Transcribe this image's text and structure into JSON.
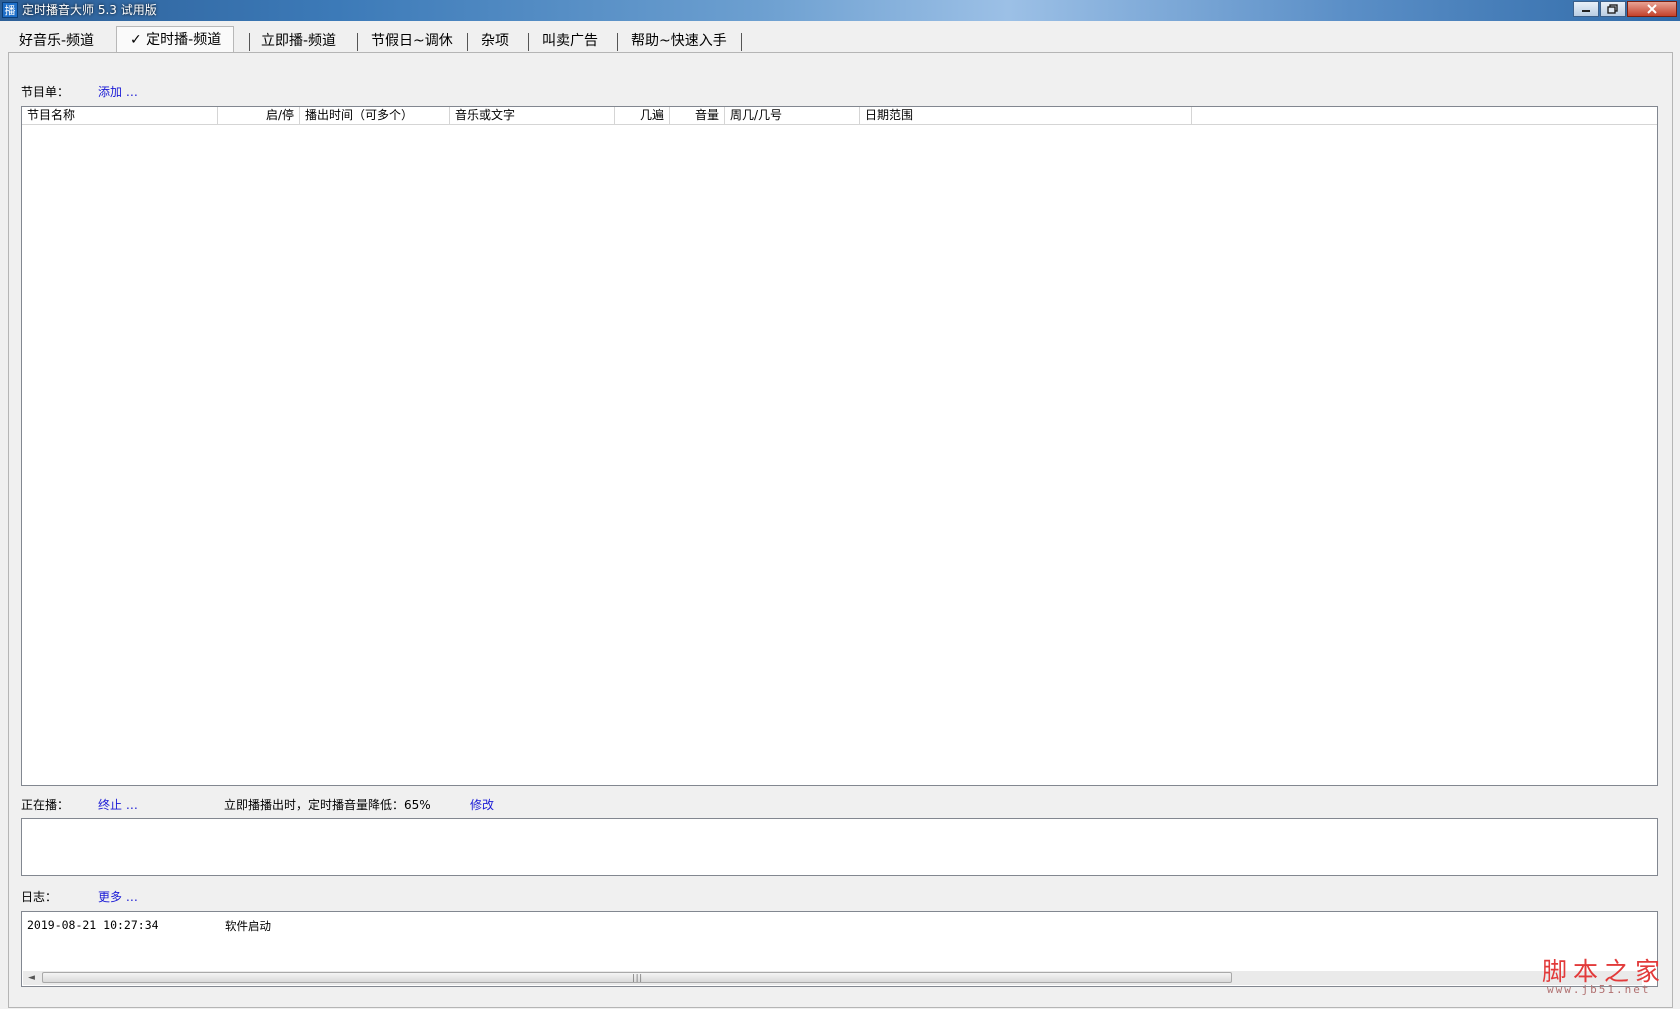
{
  "window": {
    "title": "定时播音大师 5.3 试用版",
    "icon_glyph": "播"
  },
  "tabs": [
    {
      "label": "好音乐-频道",
      "active": false
    },
    {
      "label": "✓ 定时播-频道",
      "active": true
    },
    {
      "label": "立即播-频道",
      "active": false
    },
    {
      "label": "节假日~调休",
      "active": false
    },
    {
      "label": "杂项",
      "active": false
    },
    {
      "label": "叫卖广告",
      "active": false
    },
    {
      "label": "帮助~快速入手",
      "active": false
    }
  ],
  "program_list": {
    "label": "节目单：",
    "add_link": "添加 …",
    "columns": [
      "节目名称",
      "启/停",
      "播出时间（可多个）",
      "音乐或文字",
      "几遍",
      "音量",
      "周几/几号",
      "日期范围"
    ],
    "rows": []
  },
  "now_playing": {
    "label": "正在播：",
    "stop_link": "终止 …",
    "info": "立即播播出时，定时播音量降低：65%",
    "modify_link": "修改"
  },
  "log": {
    "label": "日志：",
    "more_link": "更多 …",
    "entries": [
      {
        "time": "2019-08-21 10:27:34",
        "message": "软件启动"
      }
    ],
    "scroll_grip": "|||"
  },
  "watermark": {
    "text": "脚本之家",
    "url": "www.jb51.net"
  },
  "colors": {
    "link": "#1a1ad6",
    "watermark": "#e23a3a",
    "title_bar": "#3c7ab8"
  }
}
